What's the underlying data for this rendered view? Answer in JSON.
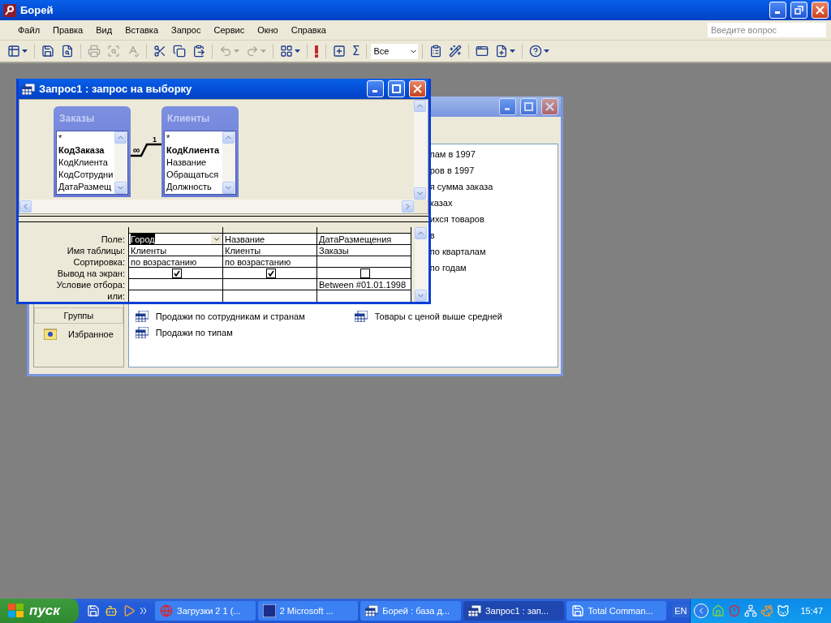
{
  "app": {
    "title": "Борей"
  },
  "menu": [
    "Файл",
    "Правка",
    "Вид",
    "Вставка",
    "Запрос",
    "Сервис",
    "Окно",
    "Справка"
  ],
  "help_search": {
    "placeholder": "Введите вопрос"
  },
  "toolbar": [
    {
      "kind": "view",
      "dropdown": true,
      "disabled": false
    },
    {
      "kind": "sep"
    },
    {
      "kind": "save",
      "dropdown": false,
      "disabled": false
    },
    {
      "kind": "file_search",
      "dropdown": false,
      "disabled": false
    },
    {
      "kind": "sep"
    },
    {
      "kind": "print",
      "dropdown": false,
      "disabled": true
    },
    {
      "kind": "preview",
      "dropdown": false,
      "disabled": true
    },
    {
      "kind": "spelling",
      "dropdown": false,
      "disabled": true
    },
    {
      "kind": "sep"
    },
    {
      "kind": "cut",
      "dropdown": false,
      "disabled": false
    },
    {
      "kind": "copy",
      "dropdown": false,
      "disabled": false
    },
    {
      "kind": "paste",
      "dropdown": false,
      "disabled": false
    },
    {
      "kind": "sep"
    },
    {
      "kind": "undo",
      "dropdown": true,
      "disabled": true
    },
    {
      "kind": "redo",
      "dropdown": true,
      "disabled": true
    },
    {
      "kind": "sep"
    },
    {
      "kind": "query_type",
      "dropdown": true,
      "disabled": false
    },
    {
      "kind": "sep"
    },
    {
      "kind": "run",
      "dropdown": false,
      "disabled": false
    },
    {
      "kind": "sep"
    },
    {
      "kind": "show_table",
      "dropdown": false,
      "disabled": false
    },
    {
      "kind": "totals",
      "label": "Σ",
      "dropdown": false,
      "disabled": false
    },
    {
      "kind": "sep"
    },
    {
      "kind": "combo",
      "value": "Все"
    },
    {
      "kind": "sep"
    },
    {
      "kind": "properties",
      "dropdown": false,
      "disabled": false
    },
    {
      "kind": "builder",
      "dropdown": false,
      "disabled": false
    },
    {
      "kind": "sep"
    },
    {
      "kind": "db_window",
      "dropdown": false,
      "disabled": false
    },
    {
      "kind": "new_object",
      "dropdown": true,
      "disabled": false
    },
    {
      "kind": "sep"
    },
    {
      "kind": "help",
      "dropdown": true,
      "disabled": false
    }
  ],
  "db_window": {
    "groups_button": "Группы",
    "favorites": "Избранное",
    "left_items": [
      "Продажи по сотрудникам и странам",
      "Продажи по типам"
    ],
    "right_cut_items": [
      "пам в 1997",
      "ров в 1997",
      "я сумма заказа",
      "казах",
      "ихся товаров",
      "в",
      "по кварталам",
      "по годам"
    ],
    "right_items": [
      "Товары с ценой выше средней"
    ]
  },
  "query_window": {
    "title": "Запрос1 : запрос на выборку",
    "tables": [
      {
        "name": "Заказы",
        "fields": [
          {
            "name": "*",
            "key": false
          },
          {
            "name": "КодЗаказа",
            "key": true
          },
          {
            "name": "КодКлиента",
            "key": false
          },
          {
            "name": "КодСотрудни",
            "key": false
          },
          {
            "name": "ДатаРазмещ",
            "key": false
          }
        ]
      },
      {
        "name": "Клиенты",
        "fields": [
          {
            "name": "*",
            "key": false
          },
          {
            "name": "КодКлиента",
            "key": true
          },
          {
            "name": "Название",
            "key": false
          },
          {
            "name": "Обращаться",
            "key": false
          },
          {
            "name": "Должность",
            "key": false
          }
        ]
      }
    ],
    "relation": {
      "many": "∞",
      "one": "1"
    },
    "grid": {
      "row_labels": [
        "Поле:",
        "Имя таблицы:",
        "Сортировка:",
        "Вывод на экран:",
        "Условие отбора:",
        "или:"
      ],
      "columns": [
        {
          "field": "Город",
          "selected": true,
          "table": "Клиенты",
          "sort": "по возрастанию",
          "show": true
        },
        {
          "field": "Название",
          "selected": false,
          "table": "Клиенты",
          "sort": "по возрастанию",
          "show": true
        },
        {
          "field": "ДатаРазмещения",
          "selected": false,
          "table": "Заказы",
          "show": false,
          "criteria": "Between #01.01.1998"
        }
      ]
    }
  },
  "taskbar": {
    "start": "пуск",
    "tasks": [
      {
        "label": "Загрузки 2 1 (...",
        "kind": "browser",
        "selected": false
      },
      {
        "label": "2 Microsoft ...",
        "kind": "word",
        "selected": false
      },
      {
        "label": "Борей : база д...",
        "kind": "access",
        "selected": false
      },
      {
        "label": "Запрос1 : зап...",
        "kind": "query",
        "selected": true
      },
      {
        "label": "Total Comman...",
        "kind": "floppy",
        "selected": false
      }
    ],
    "language": "EN",
    "clock": "15:47"
  }
}
